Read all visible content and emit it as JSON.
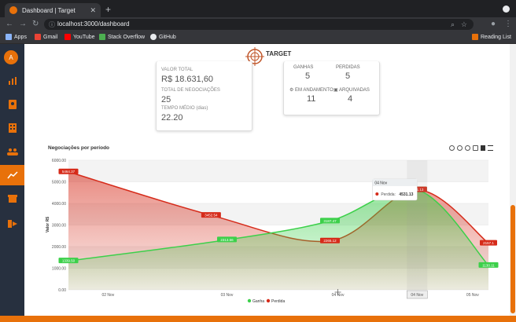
{
  "browser": {
    "tab_title": "Dashboard | Target",
    "url": "localhost:3000/dashboard",
    "bookmarks": [
      "Apps",
      "Gmail",
      "YouTube",
      "Stack Overflow",
      "GitHub"
    ],
    "reading_list": "Reading List"
  },
  "sidebar": {
    "avatar_letter": "A",
    "items": [
      "chart-bar-icon",
      "contacts-icon",
      "building-icon",
      "users-icon",
      "line-chart-icon",
      "archive-icon",
      "logout-icon"
    ],
    "active_item": "line-chart-icon"
  },
  "brand": {
    "name": "TARGET"
  },
  "stats": {
    "valor_total_label": "VALOR TOTAL",
    "valor_total": "R$ 18.631,60",
    "total_negociacoes_label": "TOTAL DE NEGOCIAÇÕES",
    "total_negociacoes": "25",
    "tempo_medio_label": "TEMPO MÉDIO (dias)",
    "tempo_medio": "22.20"
  },
  "status": {
    "ganhas_label": "GANHAS",
    "ganhas": "5",
    "perdidas_label": "PERDIDAS",
    "perdidas": "5",
    "andamento_label": "EM ANDAMENTO",
    "andamento": "11",
    "arquivadas_label": "ARQUIVADAS",
    "arquivadas": "4"
  },
  "chart_title": "Negociações por período",
  "colors": {
    "accent": "#e8710a",
    "ganha": "#3cd04a",
    "perdida": "#d62b1a"
  },
  "chart_data": {
    "type": "area",
    "title": "Negociações por período",
    "ylabel": "Valor R$",
    "ylim": [
      0,
      6000
    ],
    "yticks": [
      "0.00",
      "1000.00",
      "2000.00",
      "3000.00",
      "4000.00",
      "5000.00",
      "6000.00"
    ],
    "x_labels": [
      "02 Nov",
      "03 Nov",
      "04 Nov",
      "04 Nov",
      "05 Nov"
    ],
    "series": [
      {
        "name": "Ganha",
        "points": [
          [
            0,
            1339
          ],
          [
            2,
            2313
          ],
          [
            3.3,
            3187
          ],
          [
            4.4,
            4631
          ],
          [
            5.3,
            1130
          ]
        ],
        "labels": [
          "1339.50",
          "2313.56",
          "3187.47",
          "4631.13",
          "1130.11"
        ]
      },
      {
        "name": "Perdida",
        "points": [
          [
            0,
            5464
          ],
          [
            1.8,
            3452
          ],
          [
            3.3,
            2265
          ],
          [
            4.4,
            4631
          ],
          [
            5.3,
            2157
          ]
        ],
        "labels": [
          "5464.37",
          "3452.54",
          "2265.12",
          "4631.13",
          "2157.1"
        ]
      }
    ],
    "tooltip": {
      "title": "04 Nov",
      "series": "Perdida",
      "value": "4531.13"
    },
    "legend": [
      "Ganha",
      "Perdida"
    ],
    "legend_position": "bottom"
  }
}
